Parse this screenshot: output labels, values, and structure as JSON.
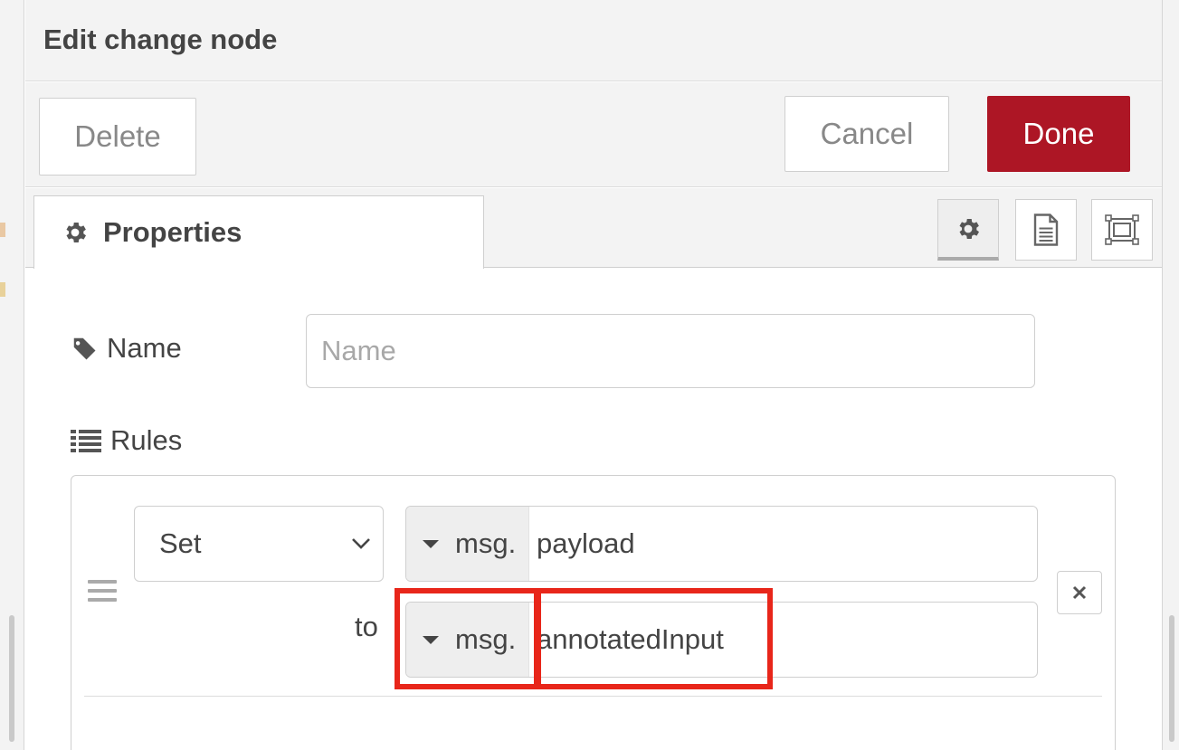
{
  "tray": {
    "title": "Edit change node"
  },
  "toolbar": {
    "delete_label": "Delete",
    "cancel_label": "Cancel",
    "done_label": "Done"
  },
  "tabs": {
    "properties_label": "Properties",
    "icons": [
      "gear-icon",
      "document-icon",
      "appearance-icon"
    ]
  },
  "form": {
    "name_label": "Name",
    "name_placeholder": "Name",
    "name_value": "",
    "rules_label": "Rules"
  },
  "rule": {
    "action": "Set",
    "target_type": "msg.",
    "target_value": "payload",
    "to_label": "to",
    "source_type": "msg.",
    "source_value": "annotatedInput"
  },
  "colors": {
    "done_button": "#ad1625",
    "highlight": "#e8261a"
  }
}
